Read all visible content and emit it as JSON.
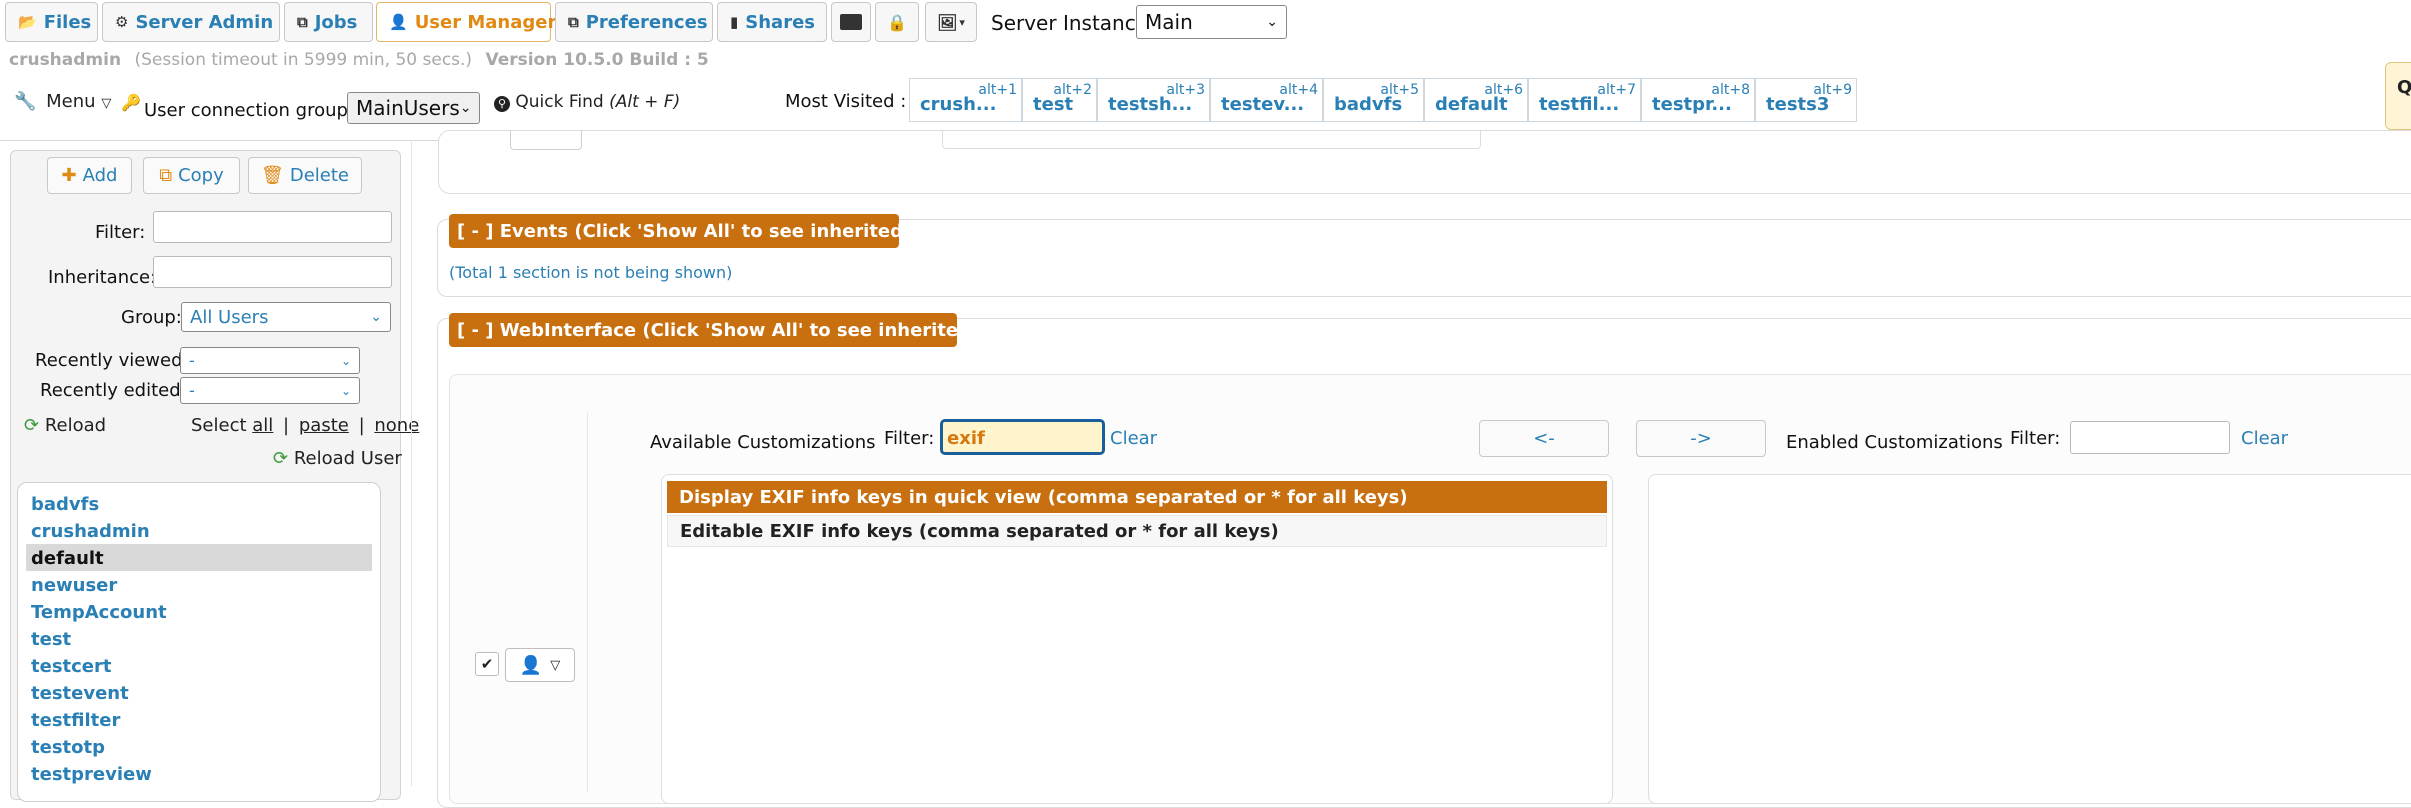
{
  "nav": {
    "tabs": [
      {
        "label": "Files",
        "icon": "folder-icon"
      },
      {
        "label": "Server Admin",
        "icon": "gear-icon"
      },
      {
        "label": "Jobs",
        "icon": "jobs-icon"
      },
      {
        "label": "User Manager",
        "icon": "user-icon"
      },
      {
        "label": "Preferences",
        "icon": "preferences-icon"
      },
      {
        "label": "Shares",
        "icon": "shares-icon"
      }
    ],
    "server_instance_label": "Server Instance:",
    "server_instance_value": "Main"
  },
  "session": {
    "user": "crushadmin",
    "timeout": "(Session timeout in 5999 min, 50 secs.)",
    "version": "Version 10.5.0 Build : 5"
  },
  "toolbar": {
    "menu_label": "Menu",
    "group_label": "User connection group:",
    "group_value": "MainUsers",
    "quickfind_label": "Quick Find",
    "quickfind_shortcut": "(Alt + F)",
    "most_visited_label": "Most Visited :",
    "most_visited": [
      {
        "label": "crush...",
        "key": "alt+1"
      },
      {
        "label": "test",
        "key": "alt+2"
      },
      {
        "label": "testsh...",
        "key": "alt+3"
      },
      {
        "label": "testev...",
        "key": "alt+4"
      },
      {
        "label": "badvfs",
        "key": "alt+5"
      },
      {
        "label": "default",
        "key": "alt+6"
      },
      {
        "label": "testfil...",
        "key": "alt+7"
      },
      {
        "label": "testpr...",
        "key": "alt+8"
      },
      {
        "label": "tests3",
        "key": "alt+9"
      }
    ],
    "edge_tab": "Q"
  },
  "sidebar": {
    "add": "Add",
    "copy": "Copy",
    "delete": "Delete",
    "filter_label": "Filter:",
    "filter_value": "",
    "inheritance_label": "Inheritance:",
    "inheritance_value": "",
    "group_label": "Group:",
    "group_value": "All Users",
    "recently_viewed_label": "Recently viewed:",
    "recently_viewed_value": "-",
    "recently_edited_label": "Recently edited:",
    "recently_edited_value": "-",
    "reload": "Reload",
    "select_label": "Select",
    "select_all": "all",
    "select_paste": "paste",
    "select_none": "none",
    "reload_user": "Reload User",
    "users": [
      "badvfs",
      "crushadmin",
      "default",
      "newuser",
      "TempAccount",
      "test",
      "testcert",
      "testevent",
      "testfilter",
      "testotp",
      "testpreview"
    ],
    "selected_user": "default"
  },
  "main": {
    "events_header": "[ - ] Events (Click 'Show All' to see inherited items.)",
    "events_note": "(Total 1 section is not being shown)",
    "webinterface_header": "[ - ] WebInterface (Click 'Show All' to see inherited items.)",
    "available_label": "Available Customizations",
    "filter_label": "Filter:",
    "filter_value": "exif",
    "clear": "Clear",
    "move_left": "<-",
    "move_right": "->",
    "enabled_label": "Enabled Customizations",
    "enabled_filter_value": "",
    "available_items": [
      "Display EXIF info keys in quick view (comma separated or * for all keys)",
      "Editable EXIF info keys (comma separated or * for all keys)"
    ]
  },
  "colors": {
    "accent": "#c8700f",
    "link": "#2a7fb4",
    "active_tab": "#e08a14"
  }
}
